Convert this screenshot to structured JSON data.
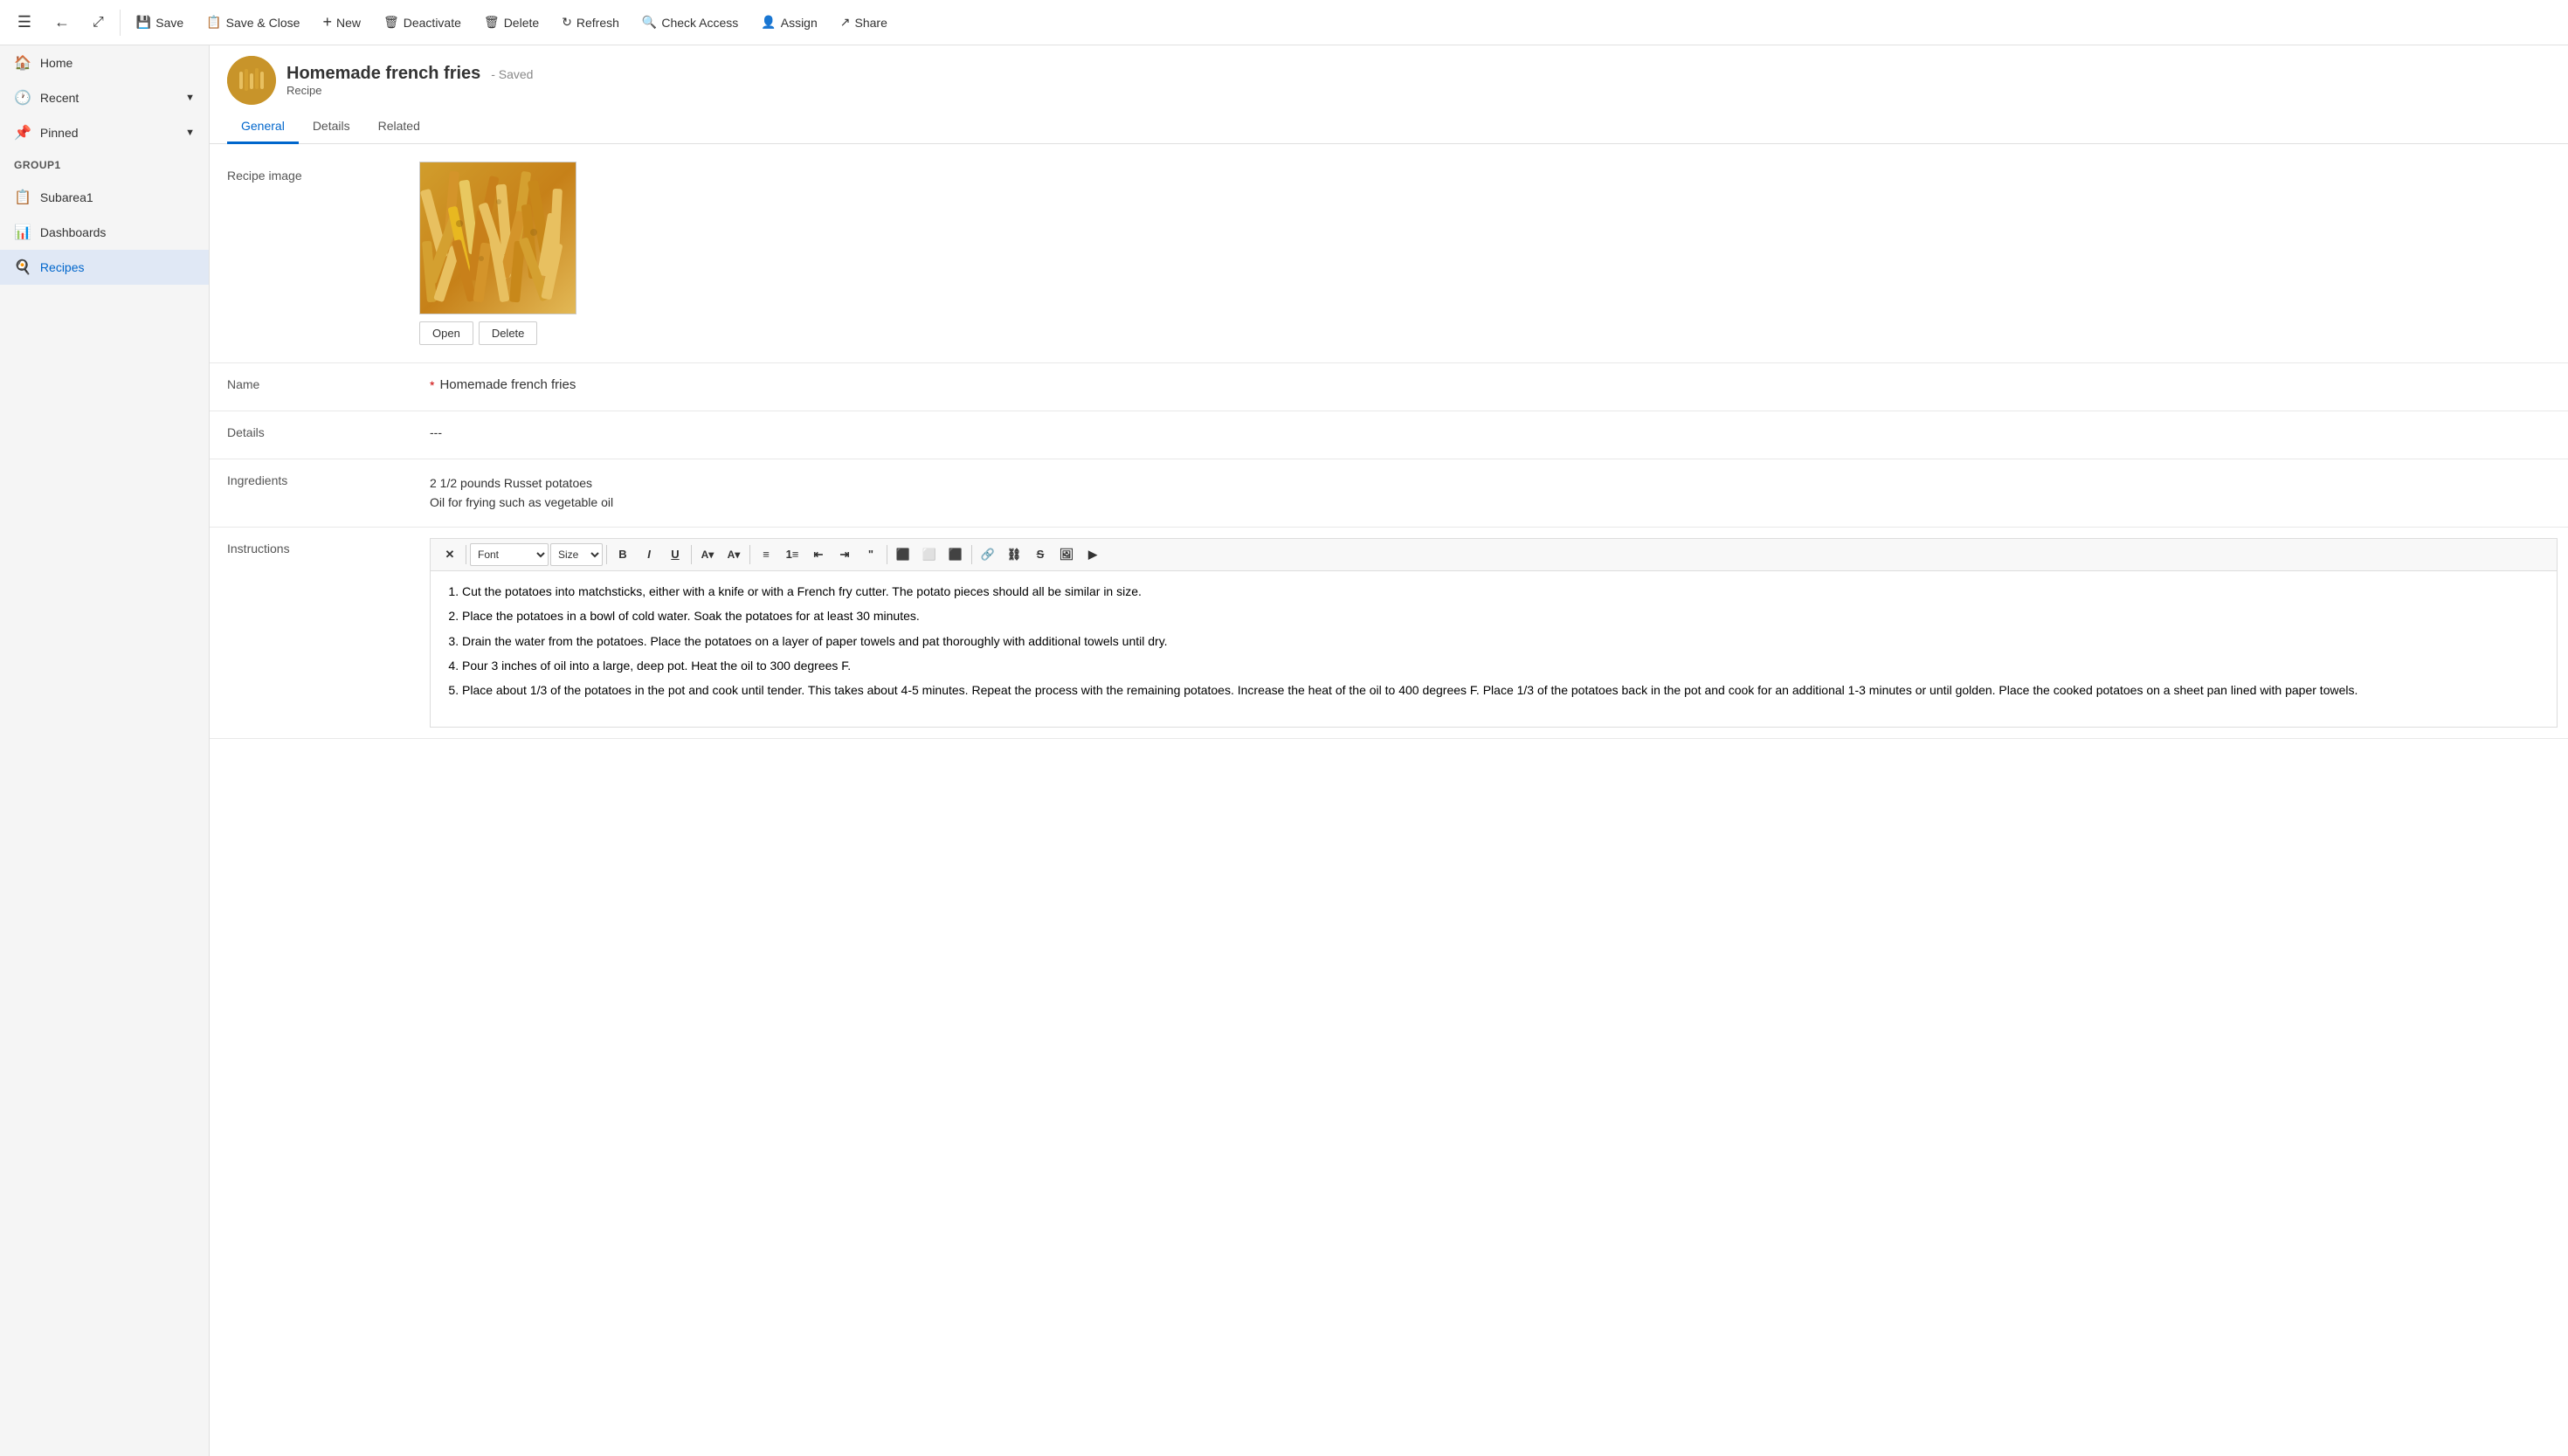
{
  "toolbar": {
    "menu_icon": "☰",
    "back_icon": "←",
    "open_new_icon": "⤢",
    "save_label": "Save",
    "save_close_label": "Save & Close",
    "new_label": "New",
    "deactivate_label": "Deactivate",
    "delete_label": "Delete",
    "refresh_label": "Refresh",
    "check_access_label": "Check Access",
    "assign_label": "Assign",
    "share_label": "Share"
  },
  "sidebar": {
    "items": [
      {
        "id": "home",
        "label": "Home",
        "icon": "🏠"
      },
      {
        "id": "recent",
        "label": "Recent",
        "icon": "🕐",
        "has_chevron": true
      },
      {
        "id": "pinned",
        "label": "Pinned",
        "icon": "📌",
        "has_chevron": true
      }
    ],
    "group1_label": "Group1",
    "group1_items": [
      {
        "id": "subarea1",
        "label": "Subarea1",
        "icon": "📋"
      },
      {
        "id": "dashboards",
        "label": "Dashboards",
        "icon": "📊"
      },
      {
        "id": "recipes",
        "label": "Recipes",
        "icon": "🍳",
        "active": true
      }
    ]
  },
  "record": {
    "title": "Homemade french fries",
    "saved_status": "- Saved",
    "type": "Recipe"
  },
  "tabs": [
    {
      "id": "general",
      "label": "General",
      "active": true
    },
    {
      "id": "details",
      "label": "Details",
      "active": false
    },
    {
      "id": "related",
      "label": "Related",
      "active": false
    }
  ],
  "form": {
    "image_label": "Recipe image",
    "image_open_btn": "Open",
    "image_delete_btn": "Delete",
    "name_label": "Name",
    "name_value": "Homemade french fries",
    "details_label": "Details",
    "details_value": "---",
    "ingredients_label": "Ingredients",
    "ingredients_line1": "2 1/2 pounds Russet potatoes",
    "ingredients_line2": "Oil for frying such as vegetable oil",
    "instructions_label": "Instructions",
    "instructions": [
      "Cut the potatoes into matchsticks, either with a knife or with a French fry cutter. The potato pieces should all be similar in size.",
      "Place the potatoes in a bowl of cold water. Soak the potatoes for at least 30 minutes.",
      "Drain the water from the potatoes. Place the potatoes on a layer of paper towels and pat thoroughly with additional towels until dry.",
      "Pour 3 inches of oil into a large, deep pot. Heat the oil to 300 degrees F.",
      "Place about 1/3 of the potatoes in the pot and cook until tender. This takes about 4-5 minutes. Repeat the process with the remaining potatoes. Increase the heat of the oil to 400 degrees F. Place 1/3 of the potatoes back in the pot and cook for an additional 1-3 minutes or until golden. Place the cooked potatoes on a sheet pan lined with paper towels."
    ]
  },
  "rich_toolbar": {
    "font_placeholder": "Font",
    "size_placeholder": "Size",
    "bold": "B",
    "italic": "I",
    "underline": "U"
  }
}
